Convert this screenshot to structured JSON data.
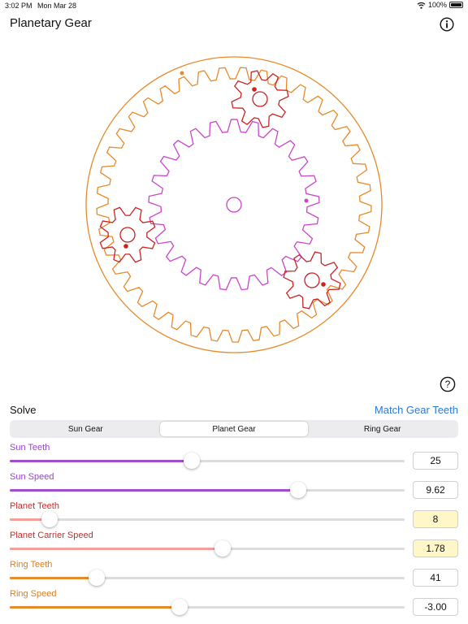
{
  "status_bar": {
    "time": "3:02 PM",
    "date": "Mon Mar 28",
    "battery": "100%"
  },
  "title": "Planetary Gear",
  "icons": {
    "info": "info-icon",
    "help": "question-icon",
    "wifi": "wifi-icon",
    "battery": "battery-icon"
  },
  "colors": {
    "sun": "#cc44cc",
    "planet": "#cc2222",
    "ring": "#e8892a",
    "accent": "#2a7ad6",
    "highlight": "#fff7c7"
  },
  "solve_label": "Solve",
  "match_button": "Match Gear Teeth",
  "segments": [
    "Sun Gear",
    "Planet Gear",
    "Ring Gear"
  ],
  "selected_segment": "Planet Gear",
  "controls": [
    {
      "label": "Sun Teeth",
      "value": "25",
      "fraction": 0.46,
      "color": "#a24dd0",
      "highlighted": false
    },
    {
      "label": "Sun Speed",
      "value": "9.62",
      "fraction": 0.73,
      "color": "#a24dd0",
      "highlighted": false
    },
    {
      "label": "Planet Teeth",
      "value": "8",
      "fraction": 0.1,
      "color": "#f2a09a",
      "highlighted": true
    },
    {
      "label": "Planet Carrier Speed",
      "value": "1.78",
      "fraction": 0.54,
      "color": "#f2a09a",
      "highlighted": true
    },
    {
      "label": "Ring Teeth",
      "value": "41",
      "fraction": 0.22,
      "color": "#e8892a",
      "highlighted": false
    },
    {
      "label": "Ring Speed",
      "value": "-3.00",
      "fraction": 0.43,
      "color": "#e8892a",
      "highlighted": false
    }
  ]
}
